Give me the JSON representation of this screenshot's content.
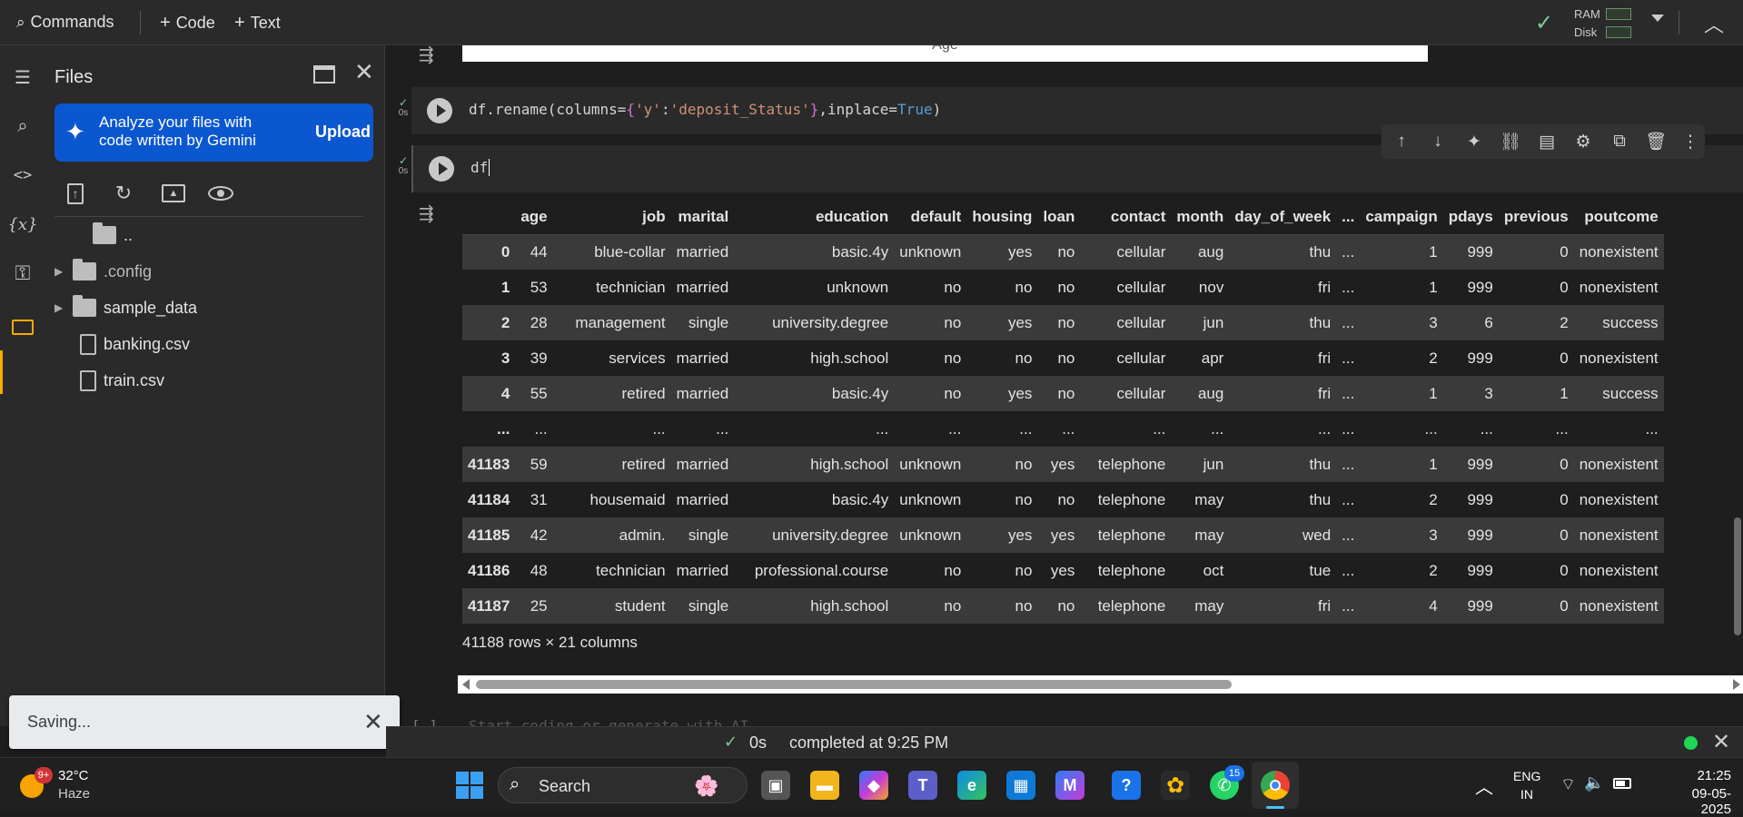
{
  "topbar": {
    "commands_label": "Commands",
    "code_label": "Code",
    "text_label": "Text",
    "ram_label": "RAM",
    "disk_label": "Disk"
  },
  "sidebar": {
    "title": "Files",
    "banner_text": "Analyze your files with code written by Gemini",
    "upload_label": "Upload",
    "tree": [
      {
        "name": "..",
        "type": "parent"
      },
      {
        "name": ".config",
        "type": "folder"
      },
      {
        "name": "sample_data",
        "type": "folder"
      },
      {
        "name": "banking.csv",
        "type": "file"
      },
      {
        "name": "train.csv",
        "type": "file"
      }
    ]
  },
  "notebook": {
    "prev_output_text": "Age",
    "cell1": {
      "exec_time": "0s",
      "code_prefix": "df.rename(columns=",
      "code_brace_open": "{",
      "code_key": "'y'",
      "code_colon": ":",
      "code_value": "'deposit_Status'",
      "code_brace_close": "}",
      "code_mid": ",inplace=",
      "code_kw": "True",
      "code_suffix": ")"
    },
    "cell2": {
      "exec_time": "0s",
      "code": "df"
    },
    "table": {
      "columns": [
        "",
        "age",
        "job",
        "marital",
        "education",
        "default",
        "housing",
        "loan",
        "contact",
        "month",
        "day_of_week",
        "...",
        "campaign",
        "pdays",
        "previous",
        "poutcome"
      ],
      "rows": [
        [
          "0",
          "44",
          "blue-collar",
          "married",
          "basic.4y",
          "unknown",
          "yes",
          "no",
          "cellular",
          "aug",
          "thu",
          "...",
          "1",
          "999",
          "0",
          "nonexistent"
        ],
        [
          "1",
          "53",
          "technician",
          "married",
          "unknown",
          "no",
          "no",
          "no",
          "cellular",
          "nov",
          "fri",
          "...",
          "1",
          "999",
          "0",
          "nonexistent"
        ],
        [
          "2",
          "28",
          "management",
          "single",
          "university.degree",
          "no",
          "yes",
          "no",
          "cellular",
          "jun",
          "thu",
          "...",
          "3",
          "6",
          "2",
          "success"
        ],
        [
          "3",
          "39",
          "services",
          "married",
          "high.school",
          "no",
          "no",
          "no",
          "cellular",
          "apr",
          "fri",
          "...",
          "2",
          "999",
          "0",
          "nonexistent"
        ],
        [
          "4",
          "55",
          "retired",
          "married",
          "basic.4y",
          "no",
          "yes",
          "no",
          "cellular",
          "aug",
          "fri",
          "...",
          "1",
          "3",
          "1",
          "success"
        ],
        [
          "...",
          "...",
          "...",
          "...",
          "...",
          "...",
          "...",
          "...",
          "...",
          "...",
          "...",
          "...",
          "...",
          "...",
          "...",
          "..."
        ],
        [
          "41183",
          "59",
          "retired",
          "married",
          "high.school",
          "unknown",
          "no",
          "yes",
          "telephone",
          "jun",
          "thu",
          "...",
          "1",
          "999",
          "0",
          "nonexistent"
        ],
        [
          "41184",
          "31",
          "housemaid",
          "married",
          "basic.4y",
          "unknown",
          "no",
          "no",
          "telephone",
          "may",
          "thu",
          "...",
          "2",
          "999",
          "0",
          "nonexistent"
        ],
        [
          "41185",
          "42",
          "admin.",
          "single",
          "university.degree",
          "unknown",
          "yes",
          "yes",
          "telephone",
          "may",
          "wed",
          "...",
          "3",
          "999",
          "0",
          "nonexistent"
        ],
        [
          "41186",
          "48",
          "technician",
          "married",
          "professional.course",
          "no",
          "no",
          "yes",
          "telephone",
          "oct",
          "tue",
          "...",
          "2",
          "999",
          "0",
          "nonexistent"
        ],
        [
          "41187",
          "25",
          "student",
          "single",
          "high.school",
          "no",
          "no",
          "no",
          "telephone",
          "may",
          "fri",
          "...",
          "4",
          "999",
          "0",
          "nonexistent"
        ]
      ],
      "shape_text": "41188 rows × 21 columns"
    },
    "next_cell_placeholder": "Start coding or generate with AI."
  },
  "toast": {
    "text": "Saving..."
  },
  "statusbar": {
    "exec_time": "0s",
    "completed_text": "completed at 9:25 PM"
  },
  "taskbar": {
    "weather_temp": "32°C",
    "weather_desc": "Haze",
    "weather_badge": "9+",
    "search_placeholder": "Search",
    "whatsapp_badge": "15",
    "lang_top": "ENG",
    "lang_bottom": "IN",
    "time": "21:25",
    "date": "09-05-2025"
  },
  "colors": {
    "accent_blue": "#0b57d0",
    "active_orange": "#f9ab00",
    "status_green": "#1fd655"
  }
}
